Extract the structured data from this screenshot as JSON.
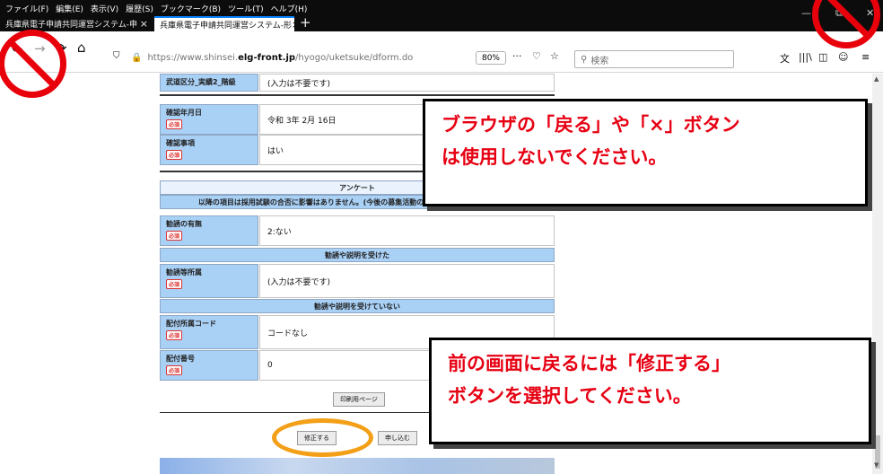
{
  "menu": [
    "ファイル(F)",
    "編集(E)",
    "表示(V)",
    "履歴(S)",
    "ブックマーク(B)",
    "ツール(T)",
    "ヘルプ(H)"
  ],
  "tabs": [
    {
      "title": "兵庫県電子申請共同運営システム-申",
      "close": "×"
    },
    {
      "title": "兵庫県電子申請共同運営システム-形",
      "close": "×"
    }
  ],
  "new_tab": "+",
  "window": {
    "minimize": "—",
    "restore": "⧉",
    "close": "✕"
  },
  "nav": {
    "back": "←",
    "forward": "→",
    "reload": "⟳",
    "home": "⌂"
  },
  "url": {
    "scheme": "https://www.shinsei.",
    "domain": "elg-front.jp",
    "path": "/hyogo/uketsuke/dform.do",
    "zoom": "80%"
  },
  "page_actions": {
    "more": "···",
    "pocket": "♡",
    "bookmark": "☆"
  },
  "search": {
    "placeholder": "検索"
  },
  "toolbar": {
    "translate": "文",
    "library": "|||\\",
    "sidebar": "◫",
    "account": "☺",
    "menu": "≡"
  },
  "form": {
    "row_top": {
      "label": "武道区分_実績2_階級",
      "value": "(入力は不要です)"
    },
    "row_date": {
      "label": "確認年月日",
      "value": "令和 3年 2月 16日"
    },
    "row_confirm": {
      "label": "確認事項",
      "value": "はい"
    },
    "required": "必須",
    "survey_header": "アンケート",
    "survey_note": "以降の項目は採用試験の合否に影響はありません。(今後の募集活動の参考とさせていただきます。)",
    "row_invite": {
      "label": "勧誘の有無",
      "value": "2:ない"
    },
    "sub_header1": "勧誘や説明を受けた",
    "row_invite_dept": {
      "label": "勧誘等所属",
      "value": "(入力は不要です)"
    },
    "sub_header2": "勧誘や説明を受けていない",
    "row_dist_code": {
      "label": "配付所属コード",
      "value": "コードなし"
    },
    "row_dist_no": {
      "label": "配付番号",
      "value": "0"
    },
    "print_button": "印刷用ページ",
    "edit_button": "修正する",
    "submit_button": "申し込む"
  },
  "callouts": {
    "top_line1": "ブラウザの「戻る」や「×」ボタン",
    "top_line2": "は使用しないでください。",
    "bottom_line1": "前の画面に戻るには「修正する」",
    "bottom_line2": "ボタンを選択してください。"
  },
  "colors": {
    "label_bg": "#a9d0f5",
    "callout_text": "#e60012",
    "ban": "#e8000b",
    "ring": "#f3a018",
    "titlebar": "#0c0c0d"
  }
}
